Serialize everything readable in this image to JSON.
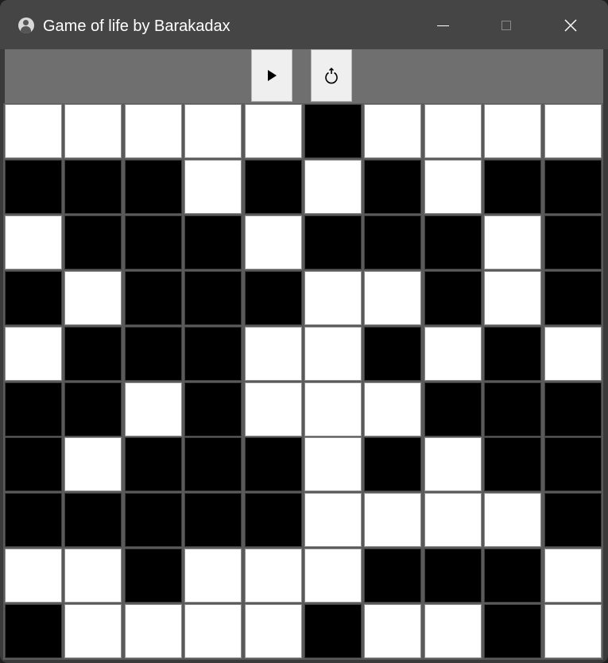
{
  "window": {
    "title": "Game of life by Barakadax",
    "controls": [
      "minimize-icon",
      "maximize-icon",
      "close-icon"
    ]
  },
  "toolbar": {
    "buttons": [
      {
        "icon": "play-icon"
      },
      {
        "icon": "reset-icon"
      }
    ]
  },
  "board": {
    "rows": 10,
    "cols": 10,
    "colors": {
      "alive": "#000000",
      "dead": "#ffffff"
    },
    "cells": [
      [
        0,
        0,
        0,
        0,
        0,
        1,
        0,
        0,
        0,
        0
      ],
      [
        1,
        1,
        1,
        0,
        1,
        0,
        1,
        0,
        1,
        1
      ],
      [
        0,
        1,
        1,
        1,
        0,
        1,
        1,
        1,
        0,
        1
      ],
      [
        1,
        0,
        1,
        1,
        1,
        0,
        0,
        1,
        0,
        1
      ],
      [
        0,
        1,
        1,
        1,
        0,
        0,
        1,
        0,
        1,
        0
      ],
      [
        1,
        1,
        0,
        1,
        0,
        0,
        0,
        1,
        1,
        1
      ],
      [
        1,
        0,
        1,
        1,
        1,
        0,
        1,
        0,
        1,
        1
      ],
      [
        1,
        1,
        1,
        1,
        1,
        0,
        0,
        0,
        0,
        1
      ],
      [
        0,
        0,
        1,
        0,
        0,
        0,
        1,
        1,
        1,
        0
      ],
      [
        1,
        0,
        0,
        0,
        0,
        1,
        0,
        0,
        1,
        0
      ]
    ]
  }
}
